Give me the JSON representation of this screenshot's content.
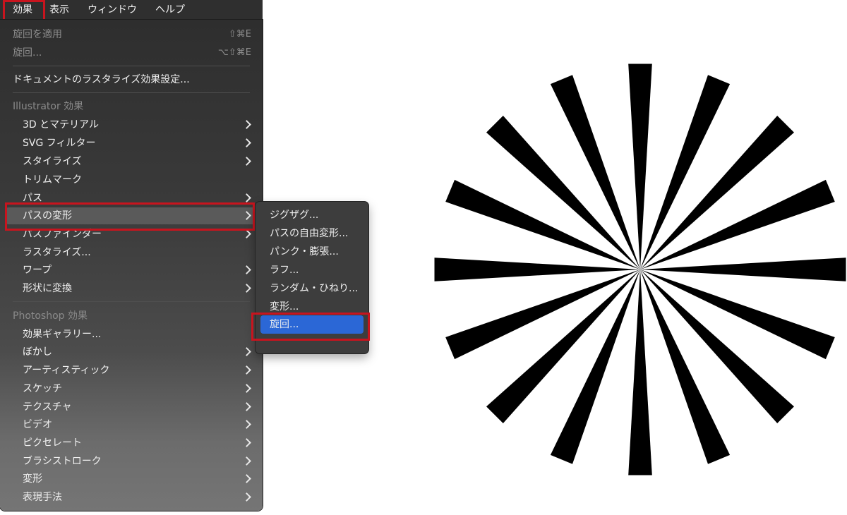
{
  "menubar": {
    "items": [
      "効果",
      "表示",
      "ウィンドウ",
      "ヘルプ"
    ]
  },
  "menu": {
    "apply_last": {
      "label": "旋回を適用",
      "shortcut": "⇧⌘E"
    },
    "last": {
      "label": "旋回...",
      "shortcut": "⌥⇧⌘E"
    },
    "doc_raster": "ドキュメントのラスタライズ効果設定...",
    "illustrator_header": "Illustrator 効果",
    "illustrator_items": [
      "3D とマテリアル",
      "SVG フィルター",
      "スタイライズ",
      "トリムマーク",
      "パス",
      "パスの変形",
      "パスファインダー",
      "ラスタライズ...",
      "ワープ",
      "形状に変換"
    ],
    "photoshop_header": "Photoshop 効果",
    "photoshop_items": [
      "効果ギャラリー...",
      "ぼかし",
      "アーティスティック",
      "スケッチ",
      "テクスチャ",
      "ビデオ",
      "ピクセレート",
      "ブラシストローク",
      "変形",
      "表現手法"
    ]
  },
  "submenu": {
    "items": [
      "ジグザグ...",
      "パスの自由変形...",
      "パンク・膨張...",
      "ラフ...",
      "ランダム・ひねり...",
      "変形...",
      "旋回..."
    ],
    "active_index": 6
  },
  "colors": {
    "highlight_box": "#c8141e",
    "active_item": "#2b67d6",
    "canvas": "#ffffff",
    "burst": "#000000"
  }
}
